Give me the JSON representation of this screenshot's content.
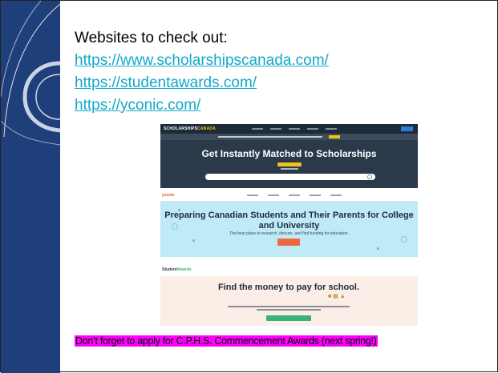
{
  "slide": {
    "heading": "Websites to check out:",
    "links": [
      "https://www.scholarshipscanada.com/",
      "https://studentawards.com/",
      "https://yconic.com/"
    ],
    "note": "Don’t forget to apply for C.P.H.S. Commencement Awards (next spring!)"
  },
  "screenshots": {
    "scholarshipscanada": {
      "logo_a": "SCHOLARSHIPS",
      "logo_b": "CANADA",
      "title": "Get Instantly Matched to Scholarships"
    },
    "yconic": {
      "logo": "yconic",
      "title": "Preparing Canadian Students and Their Parents for College and University",
      "subtitle": "The best place to research, discuss, and find funding for education."
    },
    "studentawards": {
      "logo_a": "Student",
      "logo_b": "Awards",
      "title": "Find the money to pay for school."
    }
  },
  "colors": {
    "sidebar": "#1f3f7a",
    "link": "#12a9c9",
    "highlight": "#ff00ff"
  }
}
